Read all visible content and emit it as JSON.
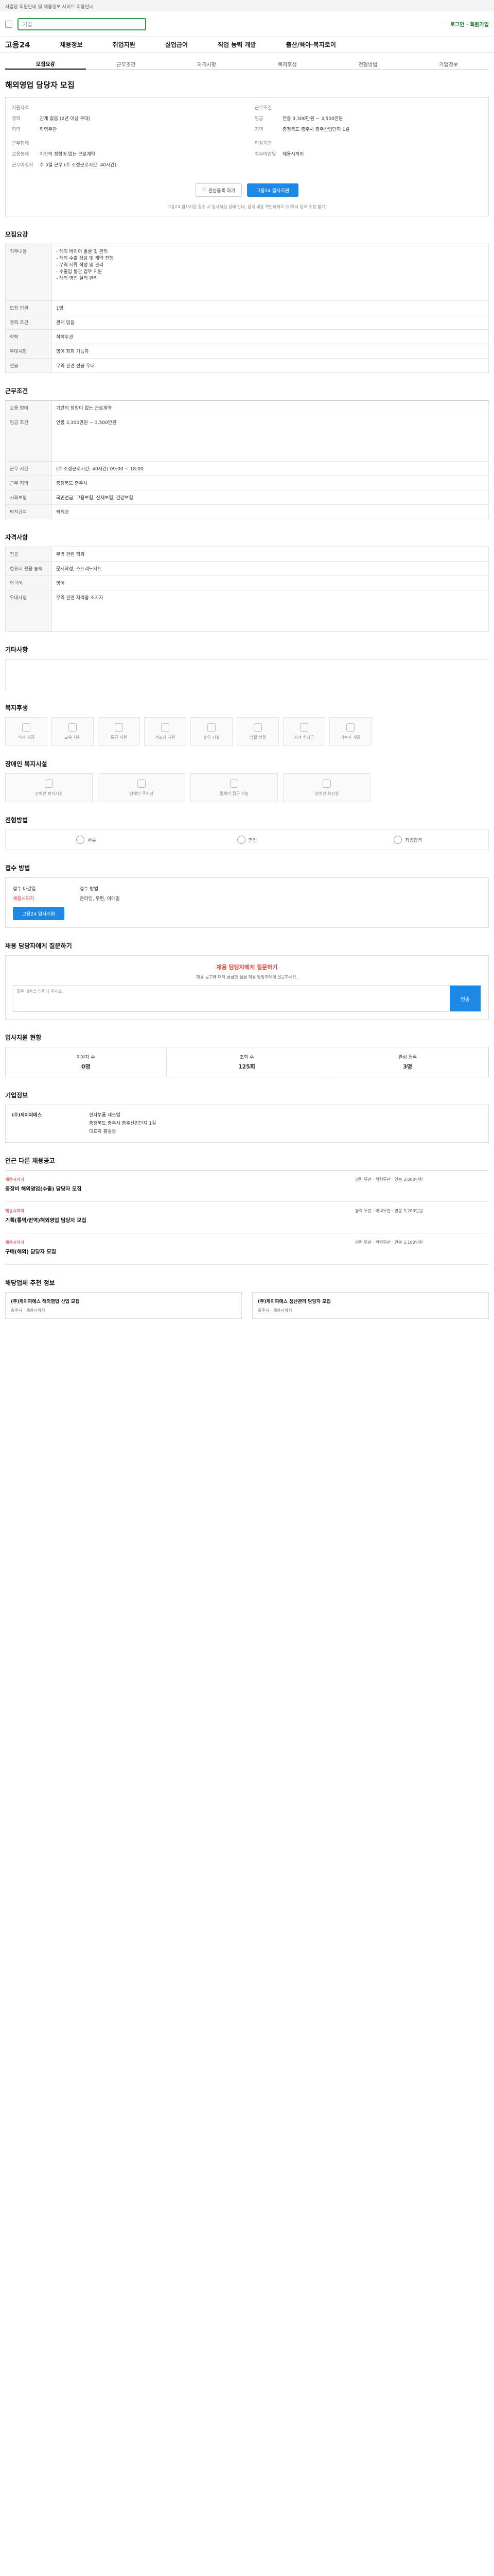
{
  "top": {
    "text": "사업장 회원안내 및 채용정보 사이트 이용안내"
  },
  "gnb": {
    "search_placeholder": "기업",
    "right": "로그인 · 회원가입"
  },
  "menu": {
    "logo": "고용24",
    "items": [
      "채용정보",
      "취업지원",
      "실업급여",
      "직업 능력 개발",
      "출산/육아·복지로이"
    ]
  },
  "tabs": [
    "모집요강",
    "근무조건",
    "자격사항",
    "복지후생",
    "전형방법",
    "기업정보"
  ],
  "title": "해외영업 담당자 모집",
  "summary": {
    "left": [
      {
        "k": "지원자격",
        "v": ""
      },
      {
        "k": "경력",
        "v": "관계 없음 (2년 이상 우대)"
      },
      {
        "k": "학력",
        "v": "학력무관"
      },
      {
        "k": "근무형태",
        "v": ""
      },
      {
        "k": "고용형태",
        "v": "기간의 정함이 없는 근로계약"
      },
      {
        "k": "근무예정지",
        "v": "주 5일 근무 (주 소정근로시간: 40시간)"
      }
    ],
    "right": [
      {
        "k": "근무조건",
        "v": ""
      },
      {
        "k": "임금",
        "v": "연봉 3,300만원 ~ 3,500만원"
      },
      {
        "k": "지역",
        "v": "충청북도 충주시 충주산업단지 1길"
      },
      {
        "k": "마감기간",
        "v": ""
      },
      {
        "k": "접수마감일",
        "v": "채용시까지"
      }
    ]
  },
  "buttons": {
    "save": "관심등록 하기",
    "apply": "고용24 입사지원"
  },
  "notice": "고용24 입사지원 접수 시 입사지원 상태 안내, 입력 내용 확인하세요 (이력서 정보 수정 불가)",
  "sections": {
    "recruit": "모집요강",
    "job_content_label": "직무내용",
    "job_content": "- 해외 바이어 발굴 및 관리\n- 해외 수출 상담 및 계약 진행\n- 무역 서류 작성 및 관리\n- 수출입 통관 업무 지원\n- 해외 영업 실적 관리",
    "rows": [
      {
        "th": "모집 인원",
        "td": "1명"
      },
      {
        "th": "경력 조건",
        "td": "관계 없음"
      },
      {
        "th": "학력",
        "td": "학력무관"
      },
      {
        "th": "우대사항",
        "td": "영어 회화 가능자"
      },
      {
        "th": "전공",
        "td": "무역 관련 전공 우대"
      }
    ],
    "cond": "근무조건",
    "cond_rows": [
      {
        "th": "고용 형태",
        "td": "기간의 정함이 없는 근로계약"
      },
      {
        "th": "임금 조건",
        "td": "연봉 3,300만원 ~ 3,500만원"
      },
      {
        "th": "근무 시간",
        "td": "(주 소정근로시간: 40시간) 09:00 ~ 18:00"
      },
      {
        "th": "근무 지역",
        "td": "충청북도 충주시"
      },
      {
        "th": "사회보험",
        "td": "국민연금, 고용보험, 산재보험, 건강보험"
      },
      {
        "th": "퇴직급여",
        "td": "퇴직금"
      }
    ],
    "qual": "자격사항",
    "qual_rows": [
      {
        "th": "전공",
        "td": "무역 관련 학과"
      },
      {
        "th": "컴퓨터 활용 능력",
        "td": "문서작성, 스프레드시트"
      },
      {
        "th": "외국어",
        "td": "영어"
      },
      {
        "th": "우대사항",
        "td": "무역 관련 자격증 소지자"
      }
    ],
    "etc": "기타사항",
    "welfare": "복지후생",
    "welfare_icons": [
      "식사 제공",
      "교육 지원",
      "통근 지원",
      "경조사 지원",
      "휴양 시설",
      "명절 선물",
      "자녀 학자금",
      "기숙사 제공"
    ],
    "welfare2": "장애인 복지시설",
    "welfare2_icons": [
      "장애인 편의시설",
      "장애인 주차장",
      "휠체어 접근 가능",
      "장애인 화장실"
    ],
    "recruit_proc": "전형방법",
    "proc_steps": [
      "서류",
      "면접",
      "최종합격"
    ],
    "apply_method": "접수 방법",
    "q": "채용 담당자에게 질문하기",
    "stats": "입사지원 현황",
    "corp": "기업정보",
    "jobs": "인근 다른 채용공고",
    "recommend": "해당업체 추천 정보"
  },
  "apply": {
    "period_label": "접수 마감일",
    "period": "채용시까지",
    "method_label": "접수 방법",
    "method": "온라인, 우편, 이메일",
    "submit": "고용24 입사지원"
  },
  "q": {
    "title": "채용 담당자에게 질문하기",
    "desc": "채용 공고에 대해 궁금한 점을 채용 담당자에게 질문하세요.",
    "placeholder": "질문 내용을 입력해 주세요.",
    "send": "전송"
  },
  "stats": [
    {
      "label": "지원자 수",
      "val": "0명"
    },
    {
      "label": "조회 수",
      "val": "125회"
    },
    {
      "label": "관심 등록",
      "val": "3명"
    }
  ],
  "corp": {
    "name": "(주)제이피에스",
    "industry": "전자부품 제조업",
    "address": "충청북도 충주시 충주산업단지 1길",
    "ceo": "대표자 홍길동"
  },
  "jobs": [
    {
      "tag": "채용시까지",
      "title": "중장비 해외영업(수출) 담당자 모집",
      "info": "경력 무관 · 학력무관 · 연봉 3,000만원"
    },
    {
      "tag": "채용시까지",
      "title": "기획(통역/번역)해외영업 담당자 모집",
      "info": "경력 무관 · 학력무관 · 연봉 3,200만원"
    },
    {
      "tag": "채용시까지",
      "title": "구매(해외) 담당자 모집",
      "info": "경력 무관 · 학력무관 · 연봉 3,100만원"
    }
  ],
  "recommend": [
    {
      "title": "(주)제이피에스 해외영업 신입 모집",
      "sub": "충주시 · 채용시까지"
    },
    {
      "title": "(주)제이피에스 생산관리 담당자 모집",
      "sub": "충주시 · 채용시까지"
    }
  ]
}
